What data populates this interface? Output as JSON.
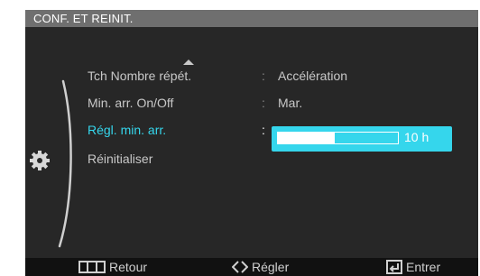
{
  "window": {
    "title": "CONF. ET REINIT."
  },
  "menu": {
    "items": [
      {
        "label": "Tch Nombre répét.",
        "value": "Accélération"
      },
      {
        "label": "Min. arr. On/Off",
        "value": "Mar."
      },
      {
        "label": "Régl. min. arr.",
        "value": "10 h",
        "progress_fraction": 0.47
      },
      {
        "label": "Réinitialiser"
      }
    ],
    "separator": ":",
    "selected_index": 2
  },
  "footer": {
    "back_label": "Retour",
    "adjust_label": "Régler",
    "enter_label": "Entrer"
  },
  "icons": {
    "scroll_up": "up-triangle-icon",
    "category": "gear-icon",
    "back": "menu-icon",
    "adjust": "left-right-arrows-icon",
    "enter": "enter-icon"
  },
  "colors": {
    "accent": "#35d6ec",
    "header_bg": "#6f6f6f",
    "panel_bg": "#272727",
    "text": "#c8c8c8"
  }
}
